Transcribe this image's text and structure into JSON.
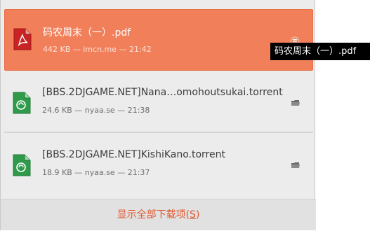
{
  "downloads": {
    "items": [
      {
        "name": "码农周末（一）.pdf",
        "meta": "442 KB — imcn.me — 21:42",
        "icon": "pdf-file-icon",
        "selected": true
      },
      {
        "name": "[BBS.2DJGAME.NET]Nana…omohoutsukai.torrent",
        "meta": "24.6 KB — nyaa.se — 21:38",
        "icon": "torrent-file-icon",
        "selected": false
      },
      {
        "name": "[BBS.2DJGAME.NET]KishiKano.torrent",
        "meta": "18.9 KB — nyaa.se — 21:37",
        "icon": "torrent-file-icon",
        "selected": false
      }
    ],
    "show_all_label": "显示全部下载项(",
    "show_all_accel": "S",
    "show_all_close": ")"
  },
  "tooltip": {
    "text": "码农周末（一）.pdf"
  },
  "colors": {
    "selected_bg": "#f07f5a",
    "link": "#e2572e",
    "panel_bg": "#ececec"
  }
}
